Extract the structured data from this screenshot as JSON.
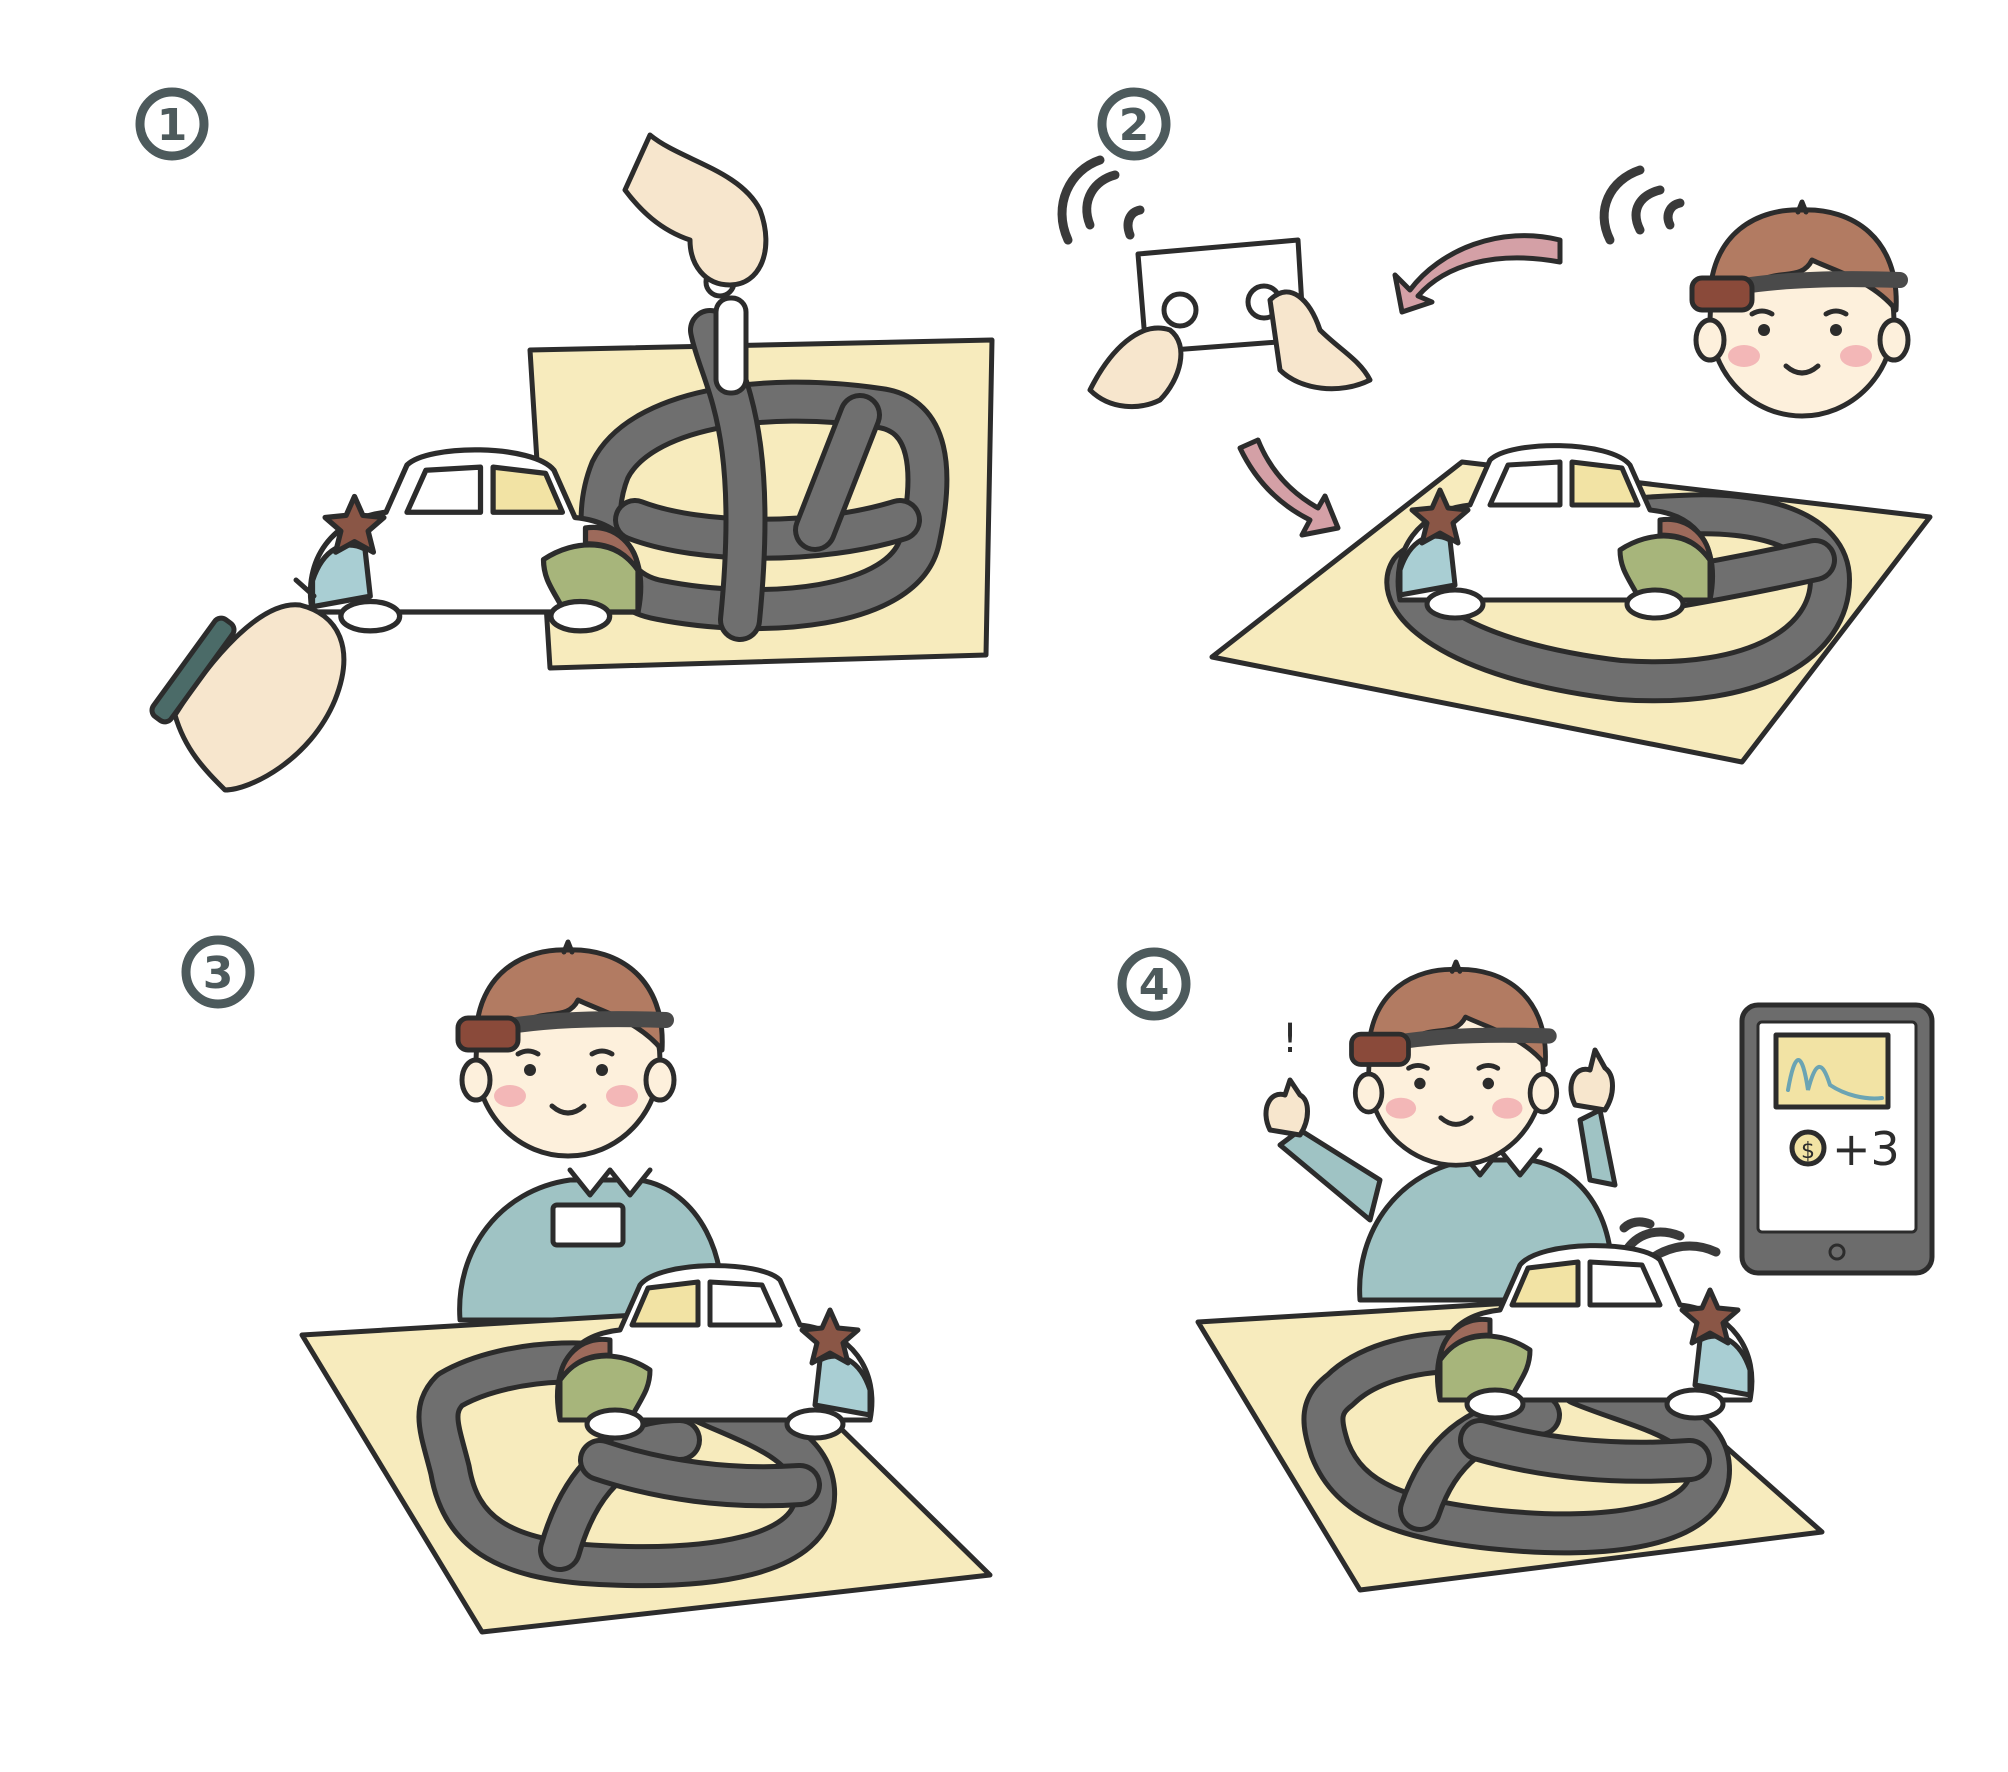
{
  "steps": [
    {
      "number": "1"
    },
    {
      "number": "2"
    },
    {
      "number": "3"
    },
    {
      "number": "4"
    }
  ],
  "tablet": {
    "reward_text": "+3",
    "coin_symbol": "$"
  },
  "exclamation": "!",
  "colors": {
    "paper": "#f7ebbd",
    "track": "#6f6f6f",
    "hair": "#b27b62",
    "headband": "#8a4a3a",
    "skin": "#fdf0dc",
    "sweater": "#9fc3c4",
    "arrow": "#d4a0a6",
    "car_green": "#a7b57b",
    "car_brown": "#9d6a5b",
    "car_blue": "#a9ced3",
    "car_yellow": "#f2e3a4",
    "number_ink": "#4d5a5c"
  }
}
